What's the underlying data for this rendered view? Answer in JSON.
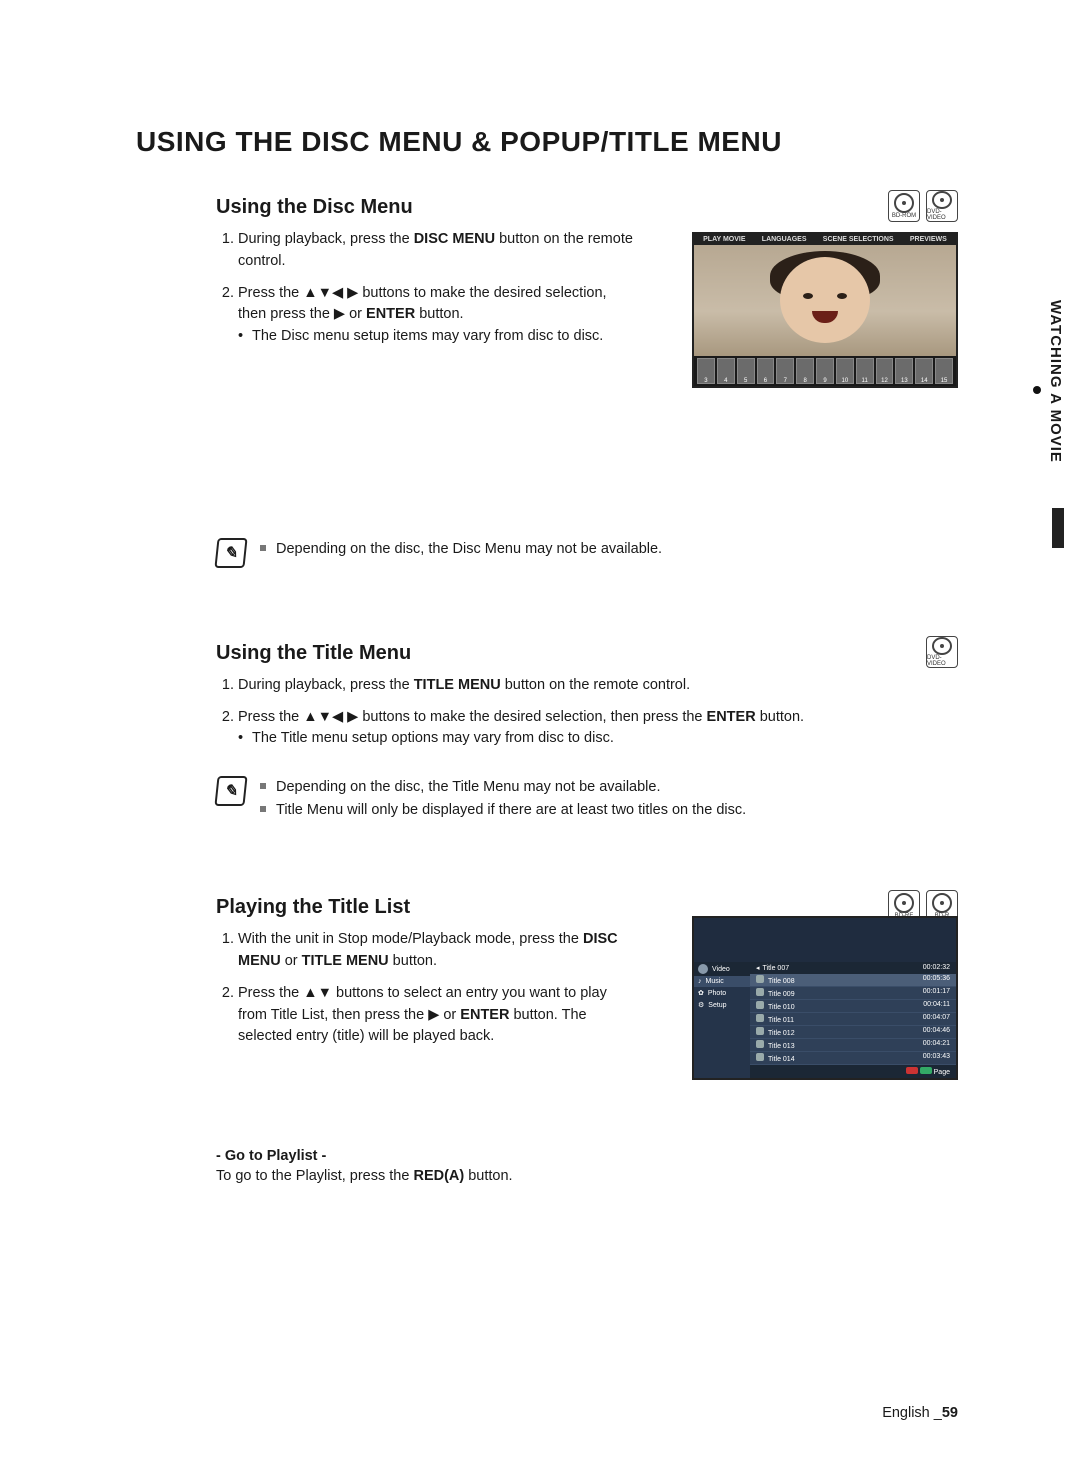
{
  "page_title": "USING THE DISC MENU & POPUP/TITLE MENU",
  "sidebar": {
    "label": "WATCHING A MOVIE"
  },
  "footer": {
    "language": "English",
    "separator": "_",
    "page": "59"
  },
  "disc_labels": {
    "bd_rom": "BD-ROM",
    "dvd_video": "DVD-VIDEO",
    "bd_re": "BD-RE",
    "bd_r": "BD-R"
  },
  "section1": {
    "heading": "Using the Disc Menu",
    "step1_a": "During playback, press the ",
    "step1_bold": "DISC MENU",
    "step1_b": " button on the remote control.",
    "step2_a": "Press the ▲▼◀ ▶ buttons to make the desired selection, then press the ▶ or ",
    "step2_bold": "ENTER",
    "step2_b": " button.",
    "step2_bullet": "The Disc menu setup items may vary from disc to disc.",
    "note1": "Depending on the disc, the Disc Menu may not be available.",
    "screenshot": {
      "tabs": [
        "PLAY MOVIE",
        "LANGUAGES",
        "SCENE SELECTIONS",
        "PREVIEWS"
      ],
      "thumbs": [
        "3",
        "4",
        "5",
        "6",
        "7",
        "8",
        "9",
        "10",
        "11",
        "12",
        "13",
        "14",
        "15"
      ]
    }
  },
  "section2": {
    "heading": "Using the Title Menu",
    "step1_a": "During playback, press the ",
    "step1_bold": "TITLE MENU",
    "step1_b": " button on the remote control.",
    "step2_a": "Press the ▲▼◀ ▶ buttons to make the desired selection, then press the ",
    "step2_bold": "ENTER",
    "step2_b": " button.",
    "step2_bullet": "The Title menu setup options may vary from disc to disc.",
    "note1": "Depending on the disc, the Title Menu may not be available.",
    "note2": "Title Menu will only be displayed if there are at least two titles on the disc."
  },
  "section3": {
    "heading": "Playing the Title List",
    "step1_a": "With the unit in Stop mode/Playback mode, press the ",
    "step1_bold": "DISC MENU",
    "step1_mid": " or ",
    "step1_bold2": "TITLE MENU",
    "step1_b": " button.",
    "step2_a": "Press the ▲▼ buttons to select an entry you want to play from Title List, then press the ▶ or ",
    "step2_bold": "ENTER",
    "step2_b": " button. The selected entry (title) will be played back.",
    "sub_heading": "- Go to Playlist -",
    "sub_text_a": "To go to the Playlist, press the ",
    "sub_text_bold": "RED(A)",
    "sub_text_b": " button.",
    "screenshot": {
      "left_header": "Video",
      "left_items": [
        "Music",
        "Photo",
        "Setup"
      ],
      "list_header_prefix": "◂",
      "list_header": "Title 007",
      "list_header_time": "00:02:32",
      "titles": [
        {
          "name": "Title 008",
          "time": "00:05:36"
        },
        {
          "name": "Title 009",
          "time": "00:01:17"
        },
        {
          "name": "Title 010",
          "time": "00:04:11"
        },
        {
          "name": "Title 011",
          "time": "00:04:07"
        },
        {
          "name": "Title 012",
          "time": "00:04:46"
        },
        {
          "name": "Title 013",
          "time": "00:04:21"
        },
        {
          "name": "Title 014",
          "time": "00:03:43"
        }
      ],
      "footer": "Page"
    }
  }
}
